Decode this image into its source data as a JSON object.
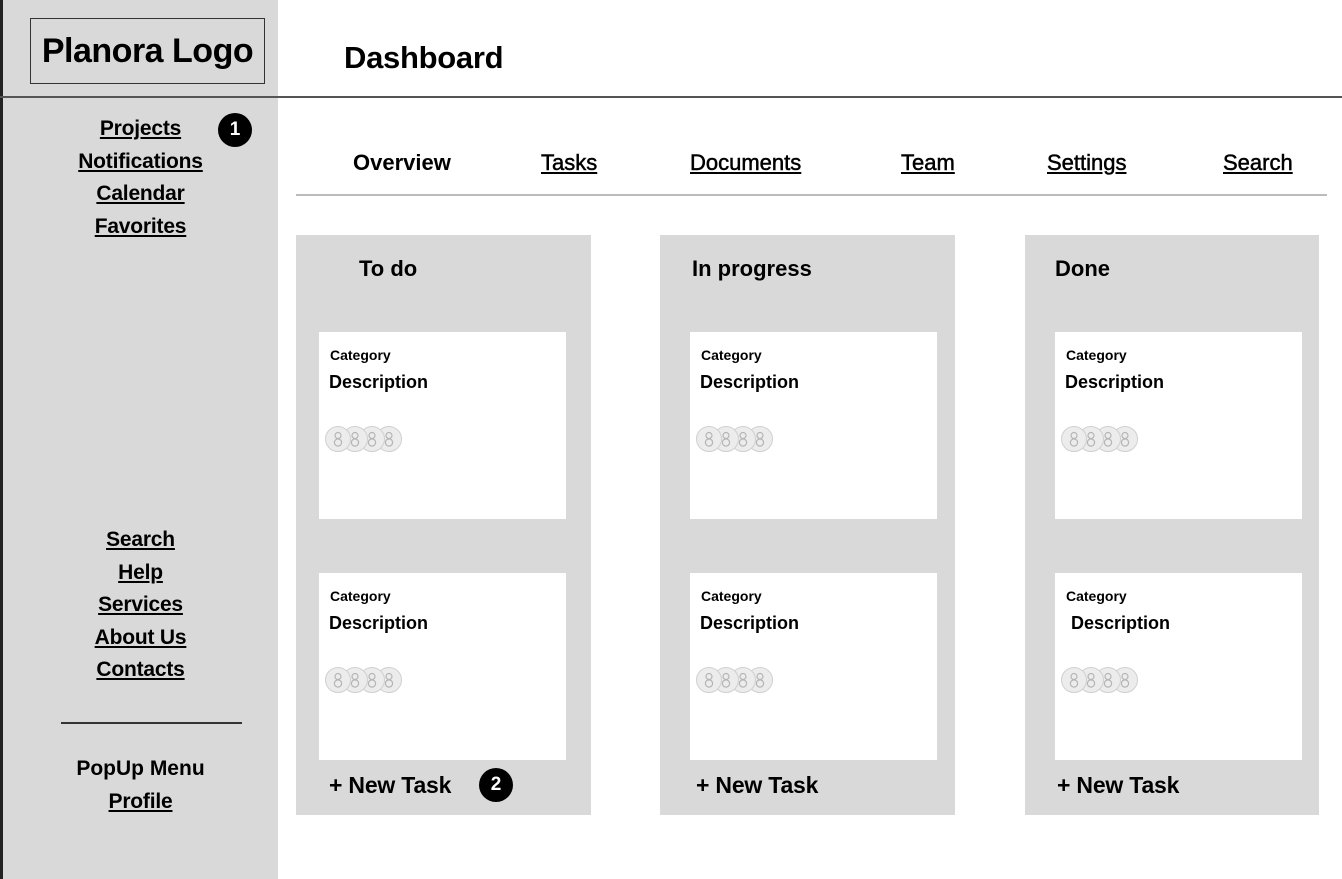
{
  "app": {
    "logo_text": "Planora Logo",
    "page_title": "Dashboard"
  },
  "sidebar": {
    "top_links": [
      "Projects",
      "Notifications",
      "Calendar",
      "Favorites"
    ],
    "mid_links": [
      "Search",
      "Help",
      "Services",
      "About Us",
      "Contacts"
    ],
    "popup_menu_label": "PopUp Menu",
    "profile_link": "Profile"
  },
  "badges": {
    "sidebar": "1",
    "new_task": "2"
  },
  "tabs": [
    {
      "label": "Overview",
      "active": true
    },
    {
      "label": "Tasks",
      "active": false
    },
    {
      "label": "Documents",
      "active": false
    },
    {
      "label": "Team",
      "active": false
    },
    {
      "label": "Settings",
      "active": false
    },
    {
      "label": "Search",
      "active": false
    }
  ],
  "board": {
    "columns": [
      {
        "title": "To do",
        "cards": [
          {
            "category": "Category",
            "description": "Description",
            "avatars": 4
          },
          {
            "category": "Category",
            "description": "Description",
            "avatars": 4
          }
        ],
        "new_task_label": "+ New Task"
      },
      {
        "title": "In progress",
        "cards": [
          {
            "category": "Category",
            "description": "Description",
            "avatars": 4
          },
          {
            "category": "Category",
            "description": "Description",
            "avatars": 4
          }
        ],
        "new_task_label": "+ New Task"
      },
      {
        "title": "Done",
        "cards": [
          {
            "category": "Category",
            "description": "Description",
            "avatars": 4
          },
          {
            "category": "Category",
            "description": "Description",
            "avatars": 4
          }
        ],
        "new_task_label": "+ New Task"
      }
    ]
  },
  "icons": {
    "avatar": "user-avatar-icon"
  },
  "colors": {
    "panel": "#d9d9d9",
    "card": "#ffffff",
    "badge": "#000000"
  }
}
